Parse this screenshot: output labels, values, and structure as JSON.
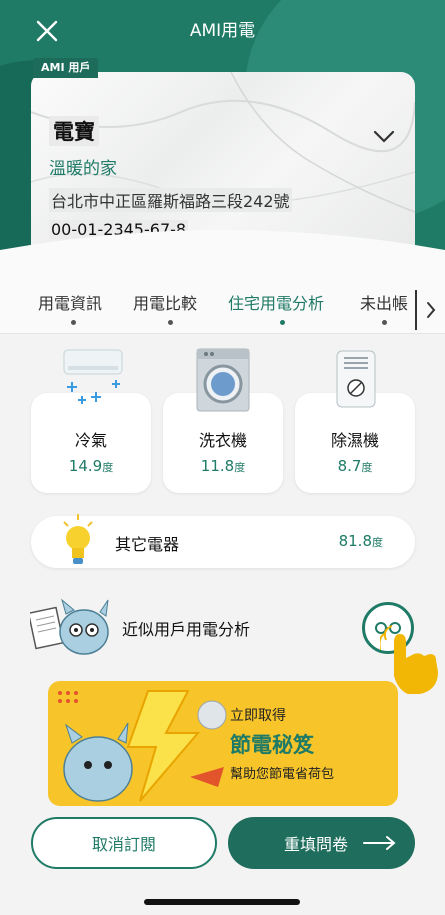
{
  "header": {
    "title": "AMI用電",
    "close_icon": "close-icon",
    "ami_tag": "AMI 用戶"
  },
  "account": {
    "name": "電寶",
    "nickname": "溫暖的家",
    "address": "台北市中正區羅斯福路三段242號",
    "number": "00-01-2345-67-8"
  },
  "tabs": [
    {
      "label": "用電資訊"
    },
    {
      "label": "用電比較"
    },
    {
      "label": "住宅用電分析",
      "active": true
    },
    {
      "label": "未出帳"
    }
  ],
  "appliances": [
    {
      "label": "冷氣",
      "value": "14.9",
      "unit": "度",
      "icon": "air-conditioner-icon"
    },
    {
      "label": "洗衣機",
      "value": "11.8",
      "unit": "度",
      "icon": "washing-machine-icon"
    },
    {
      "label": "除濕機",
      "value": "8.7",
      "unit": "度",
      "icon": "dehumidifier-icon"
    }
  ],
  "other": {
    "label": "其它電器",
    "value": "81.8",
    "unit": "度",
    "icon": "lightbulb-icon"
  },
  "similar": {
    "label": "近似用戶用電分析",
    "icon": "mascot-icon"
  },
  "banner": {
    "line1": "立即取得",
    "line2": "節電秘笈",
    "line3": "幫助您節電省荷包"
  },
  "buttons": {
    "cancel": "取消訂閱",
    "refill": "重填問卷"
  },
  "colors": {
    "brand": "#1f7a66",
    "banner": "#f7c52a"
  }
}
